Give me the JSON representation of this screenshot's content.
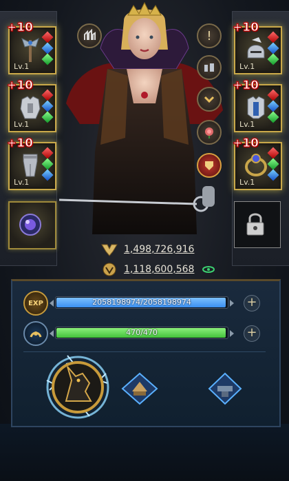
{
  "equipment": {
    "left": [
      {
        "enhance": "+10",
        "level": "Lv.1",
        "icon": "war-axe-icon"
      },
      {
        "enhance": "+10",
        "level": "Lv.1",
        "icon": "chest-armor-icon"
      },
      {
        "enhance": "+10",
        "level": "Lv.1",
        "icon": "leg-armor-icon"
      }
    ],
    "right": [
      {
        "enhance": "+10",
        "level": "Lv.1",
        "icon": "helmet-icon"
      },
      {
        "enhance": "+10",
        "level": "Lv.1",
        "icon": "plate-armor-icon"
      },
      {
        "enhance": "+10",
        "level": "Lv.1",
        "icon": "ring-icon"
      }
    ],
    "special_left": {
      "icon": "crystal-orb-icon"
    },
    "special_right": {
      "icon": "padlock-icon"
    }
  },
  "hero_actions": [
    "info-icon",
    "army-icon",
    "promote-icon",
    "rose-icon",
    "crest-icon"
  ],
  "stats": {
    "power": "1,498,726,916",
    "might": "1,118,600,568"
  },
  "bars": {
    "exp": {
      "badge": "EXP",
      "text": "2058198974/2058198974",
      "fill": 1.0,
      "color": "#3b8ff0"
    },
    "stamina": {
      "text": "470/470",
      "fill": 1.0,
      "color": "#43c23b"
    }
  },
  "skills": [
    "anubis-skill-icon",
    "camp-skill-icon",
    "anvil-skill-icon"
  ],
  "colors": {
    "gold_frame": "#caa94a",
    "exp_bar": "#3b8ff0",
    "stamina_bar": "#43c23b",
    "enhance_text": "#ff2a2a"
  }
}
